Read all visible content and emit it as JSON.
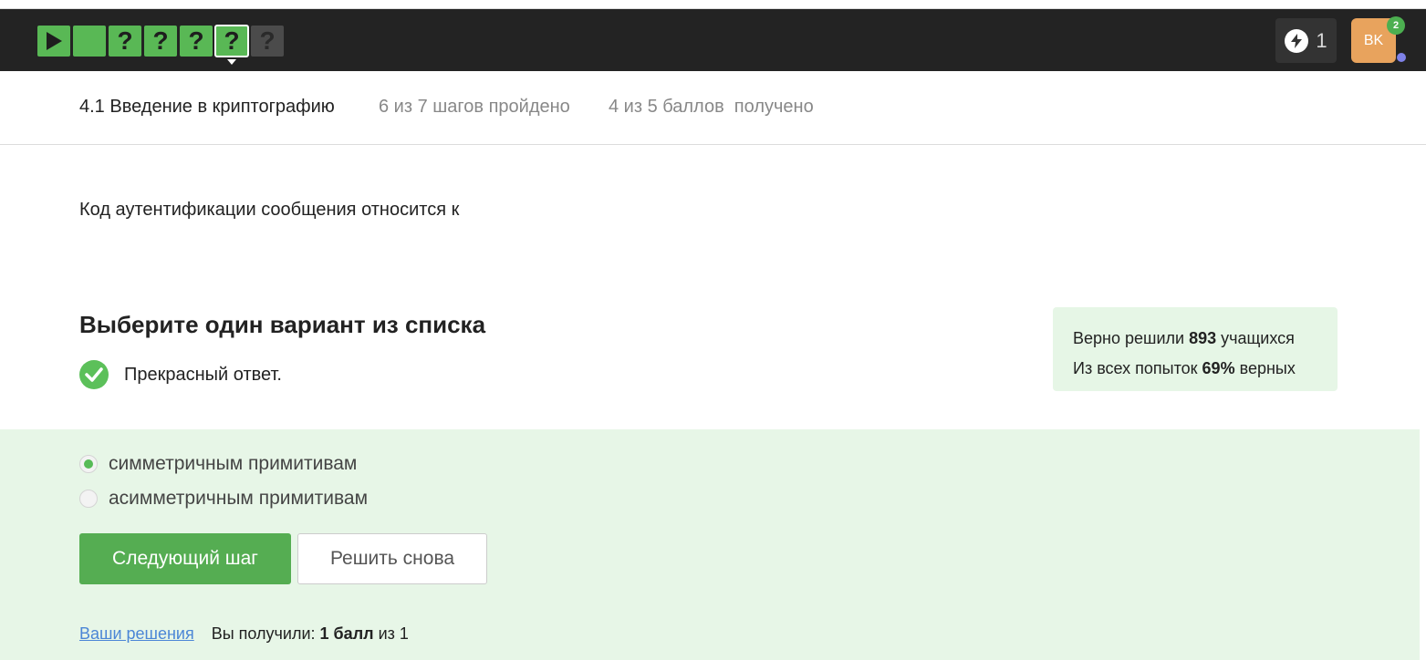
{
  "progress": {
    "steps": [
      {
        "symbol": "▶",
        "status": "passed",
        "icon": "play-icon"
      },
      {
        "symbol": "",
        "status": "passed"
      },
      {
        "symbol": "?",
        "status": "passed"
      },
      {
        "symbol": "?",
        "status": "passed"
      },
      {
        "symbol": "?",
        "status": "passed"
      },
      {
        "symbol": "?",
        "status": "current"
      },
      {
        "symbol": "?",
        "status": "not-passed"
      }
    ]
  },
  "header": {
    "energy_icon": "lightning-icon",
    "energy_count": "1",
    "avatar_initials": "BK",
    "notification_count": "2"
  },
  "lesson": {
    "title": "4.1 Введение в криптографию",
    "steps_progress": "6 из 7 шагов пройдено",
    "points_progress": "4 из 5 баллов  получено"
  },
  "question": {
    "text": "Код аутентификации сообщения относится к",
    "instruction": "Выберите один вариант из списка",
    "feedback_icon": "checkmark-circle-icon",
    "feedback": "Прекрасный ответ."
  },
  "stats": {
    "solved_prefix": "Верно решили ",
    "solved_count": "893",
    "solved_suffix": " учащихся",
    "attempts_prefix": "Из всех попыток ",
    "attempts_percent": "69%",
    "attempts_suffix": " верных"
  },
  "options": [
    {
      "label": "симметричным примитивам",
      "selected": true
    },
    {
      "label": "асимметричным примитивам",
      "selected": false
    }
  ],
  "buttons": {
    "next": "Следующий шаг",
    "retry": "Решить снова"
  },
  "footer": {
    "solutions_link": "Ваши решения",
    "score_prefix": "Вы получили: ",
    "score_value": "1 балл",
    "score_suffix": " из 1"
  },
  "colors": {
    "accent_green": "#55ad52",
    "topbar": "#232323",
    "answer_bg": "#e7f6e7",
    "avatar_bg": "#e8a35d",
    "link": "#4b86d6"
  }
}
